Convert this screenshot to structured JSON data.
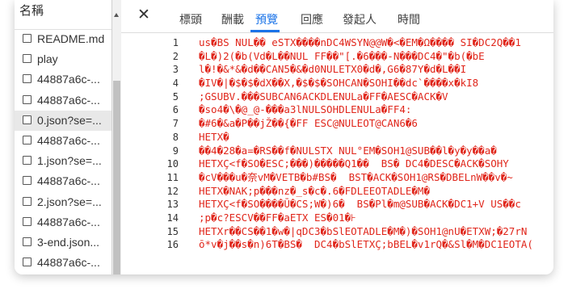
{
  "file_list": {
    "header": "名稱",
    "items": [
      {
        "name": "README.md",
        "selected": false
      },
      {
        "name": "play",
        "selected": false
      },
      {
        "name": "44887a6c-...",
        "selected": false
      },
      {
        "name": "44887a6c-...",
        "selected": false
      },
      {
        "name": "0.json?se=...",
        "selected": true
      },
      {
        "name": "44887a6c-...",
        "selected": false
      },
      {
        "name": "1.json?se=...",
        "selected": false
      },
      {
        "name": "44887a6c-...",
        "selected": false
      },
      {
        "name": "2.json?se=...",
        "selected": false
      },
      {
        "name": "44887a6c-...",
        "selected": false
      },
      {
        "name": "3-end.json...",
        "selected": false
      },
      {
        "name": "44887a6c-...",
        "selected": false
      }
    ]
  },
  "tabs": {
    "close_symbol": "✕",
    "items": [
      "標頭",
      "酬載",
      "預覽",
      "回應",
      "發起人",
      "時間"
    ],
    "active_index": 2,
    "accent_color": "#1a73e8"
  },
  "preview": {
    "text_color": "#e0261b",
    "line_numbers": [
      "1",
      "2",
      "3",
      "4",
      "5",
      "6",
      "7",
      "8",
      "9",
      "10",
      "11",
      "12",
      "13",
      "14",
      "15",
      "16"
    ],
    "lines": [
      "us�BS NUL�� eSTX����nDC4WSYN@@W�<�EM�Ω���� SI�DC2Q��1",
      "�L�)2(�b(Vd�L��NUL FF��\"[.�6���-N���DC4�\"�b(�bE",
      "l�!�&*&�d��CAN5�&�d0NULETX0�d�,G6�87Y�d�L��I",
      "�IV�|�$�$�dX��X,�$�$�SOHCAN�SOHI��dc`����x�kI8",
      ";GSUBV.���SUBCAN6ACKDLENULa�FF�AESC�ACK�V",
      "�so4�\\�@_@-���a3lNULSOHDLENULa�FF4:",
      "�#6�&a�P��jŽ��{�FF ESC@NULEOT@CAN6�6",
      "HETX�",
      "��4�28�a=�RS��f�NULSTX NUL°EM�SOH1@SUB��l�y�y��a�",
      "HETXÇ<f�SO�ESC;���)�����Q1��  BS� DC4�DESC�ACK�SOHY",
      "�cV���u�奈vM�VETB�b#BS�  BST�ACK�SOH1@RS�DBELnW��v�~",
      "HETX�NAK;p���nz�_s�c�.6�FDLEEOTADLE�M�",
      "HETXÇ<f�SO����Ū�CS;W�)6�  BS�Pl�m@SUB�ACK�DC1+V US��c",
      ";p�c?ESCV��FF�aETX ES�01�⊦",
      "HETXr��CS��1�w�|qDC3�bSlEOTADLE�M�)�SOH1@nU�ETXW;�27rN",
      "ō*v�j��s�n)6T�BS�  DC4�bSlETXÇ;bBEL�v1rQ�&Sl�M�DC1EOTA("
    ]
  }
}
